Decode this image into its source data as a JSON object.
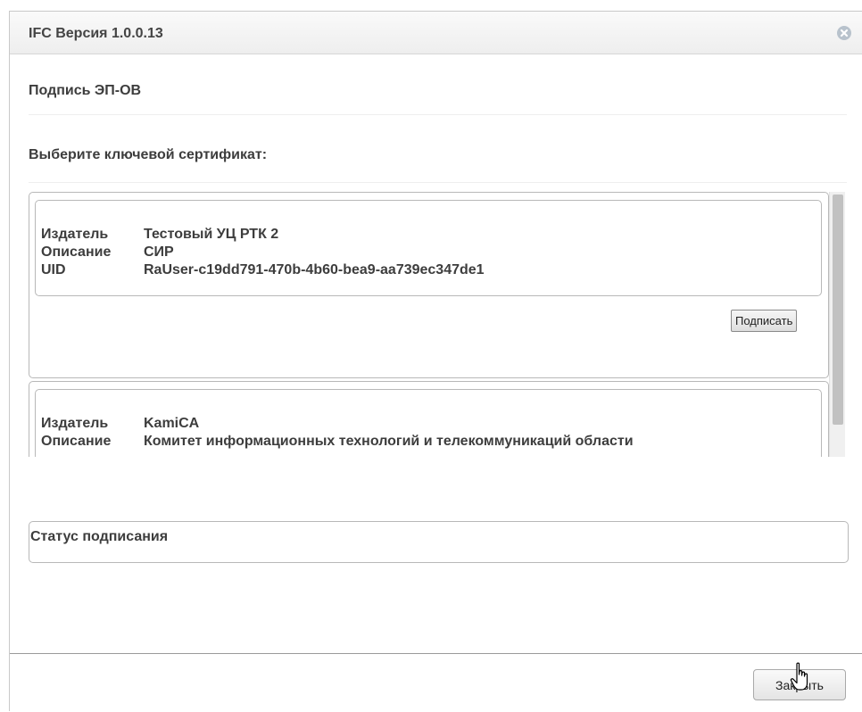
{
  "dialog": {
    "title": "IFC Версия 1.0.0.13",
    "close_icon": "close-circle-icon"
  },
  "section": {
    "heading": "Подпись ЭП-ОВ"
  },
  "certificates": {
    "heading": "Выберите ключевой сертификат:",
    "items": [
      {
        "issuer_label": "Издатель",
        "issuer": "Тестовый УЦ РТК 2",
        "description_label": "Описание",
        "description": "СИР",
        "uid_label": "UID",
        "uid": "RaUser-c19dd791-470b-4b60-bea9-aa739ec347de1",
        "sign_label": "Подписать"
      },
      {
        "issuer_label": "Издатель",
        "issuer": "KamiCA",
        "description_label": "Описание",
        "description": "Комитет информационных технологий и телекоммуникаций области"
      }
    ]
  },
  "status": {
    "label": "Статус подписания"
  },
  "footer": {
    "close_label": "Закрыть"
  },
  "cursor_icon": "hand-pointer-icon"
}
